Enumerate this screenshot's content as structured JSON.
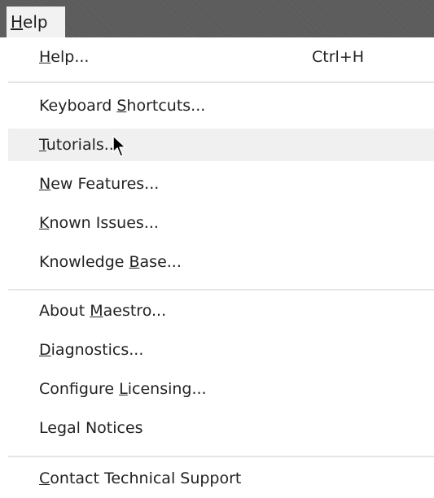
{
  "menubar": {
    "title": "Help",
    "title_underline_index": 0
  },
  "menu": {
    "items": [
      {
        "label": "Help...",
        "underline": 0,
        "shortcut": "Ctrl+H"
      },
      {
        "label": "Keyboard Shortcuts...",
        "underline": 9
      },
      {
        "label": "Tutorials...",
        "underline": 0,
        "hovered": true
      },
      {
        "label": "New Features...",
        "underline": 0
      },
      {
        "label": "Known Issues...",
        "underline": 0
      },
      {
        "label": "Knowledge Base...",
        "underline": 10
      },
      {
        "label": "About Maestro...",
        "underline": 6
      },
      {
        "label": "Diagnostics...",
        "underline": 0
      },
      {
        "label": "Configure Licensing...",
        "underline": 10
      },
      {
        "label": "Legal Notices",
        "underline": -1
      },
      {
        "label": "Contact Technical Support",
        "underline": 0
      }
    ]
  },
  "icons": {
    "cursor": "mouse-pointer-icon"
  },
  "colors": {
    "menubar_bg": "#5a5a5a",
    "menu_bg": "#ffffff",
    "hover_bg": "#f0f0f0",
    "separator": "#e6e6e6",
    "text": "#222222"
  }
}
